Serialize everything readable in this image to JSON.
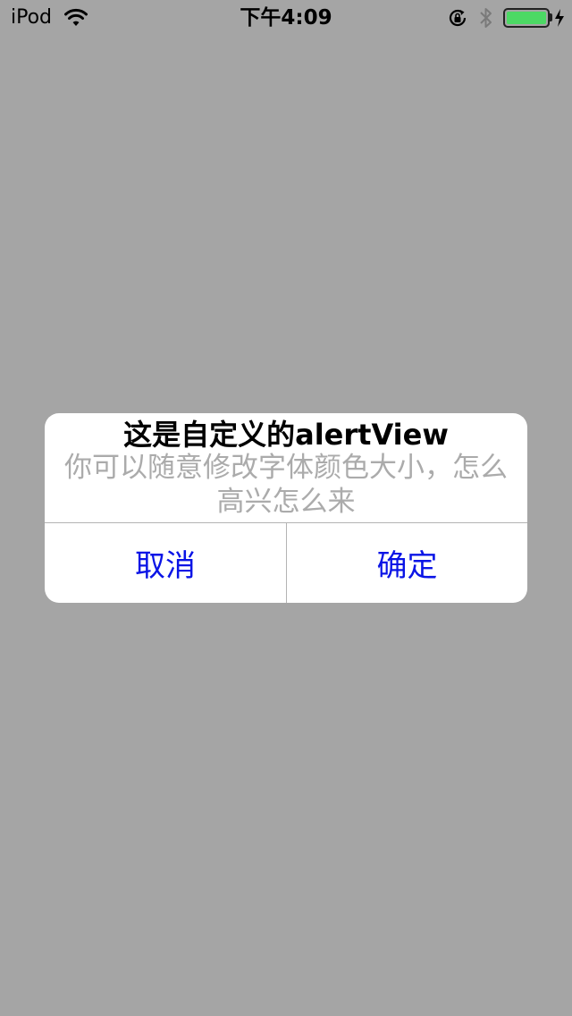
{
  "status_bar": {
    "carrier": "iPod",
    "time": "下午4:09",
    "battery_color": "#4cd964",
    "icons": [
      "wifi-icon",
      "rotation-lock-icon",
      "bluetooth-icon",
      "battery-icon",
      "charging-icon"
    ]
  },
  "alert": {
    "title": "这是自定义的alertView",
    "message": "你可以随意修改字体颜色大小，怎么高兴怎么来",
    "buttons": {
      "cancel": "取消",
      "confirm": "确定"
    },
    "title_color": "#000000",
    "message_color": "#ababab",
    "button_color": "#0a14e6"
  },
  "background_color": "#a5a5a5"
}
